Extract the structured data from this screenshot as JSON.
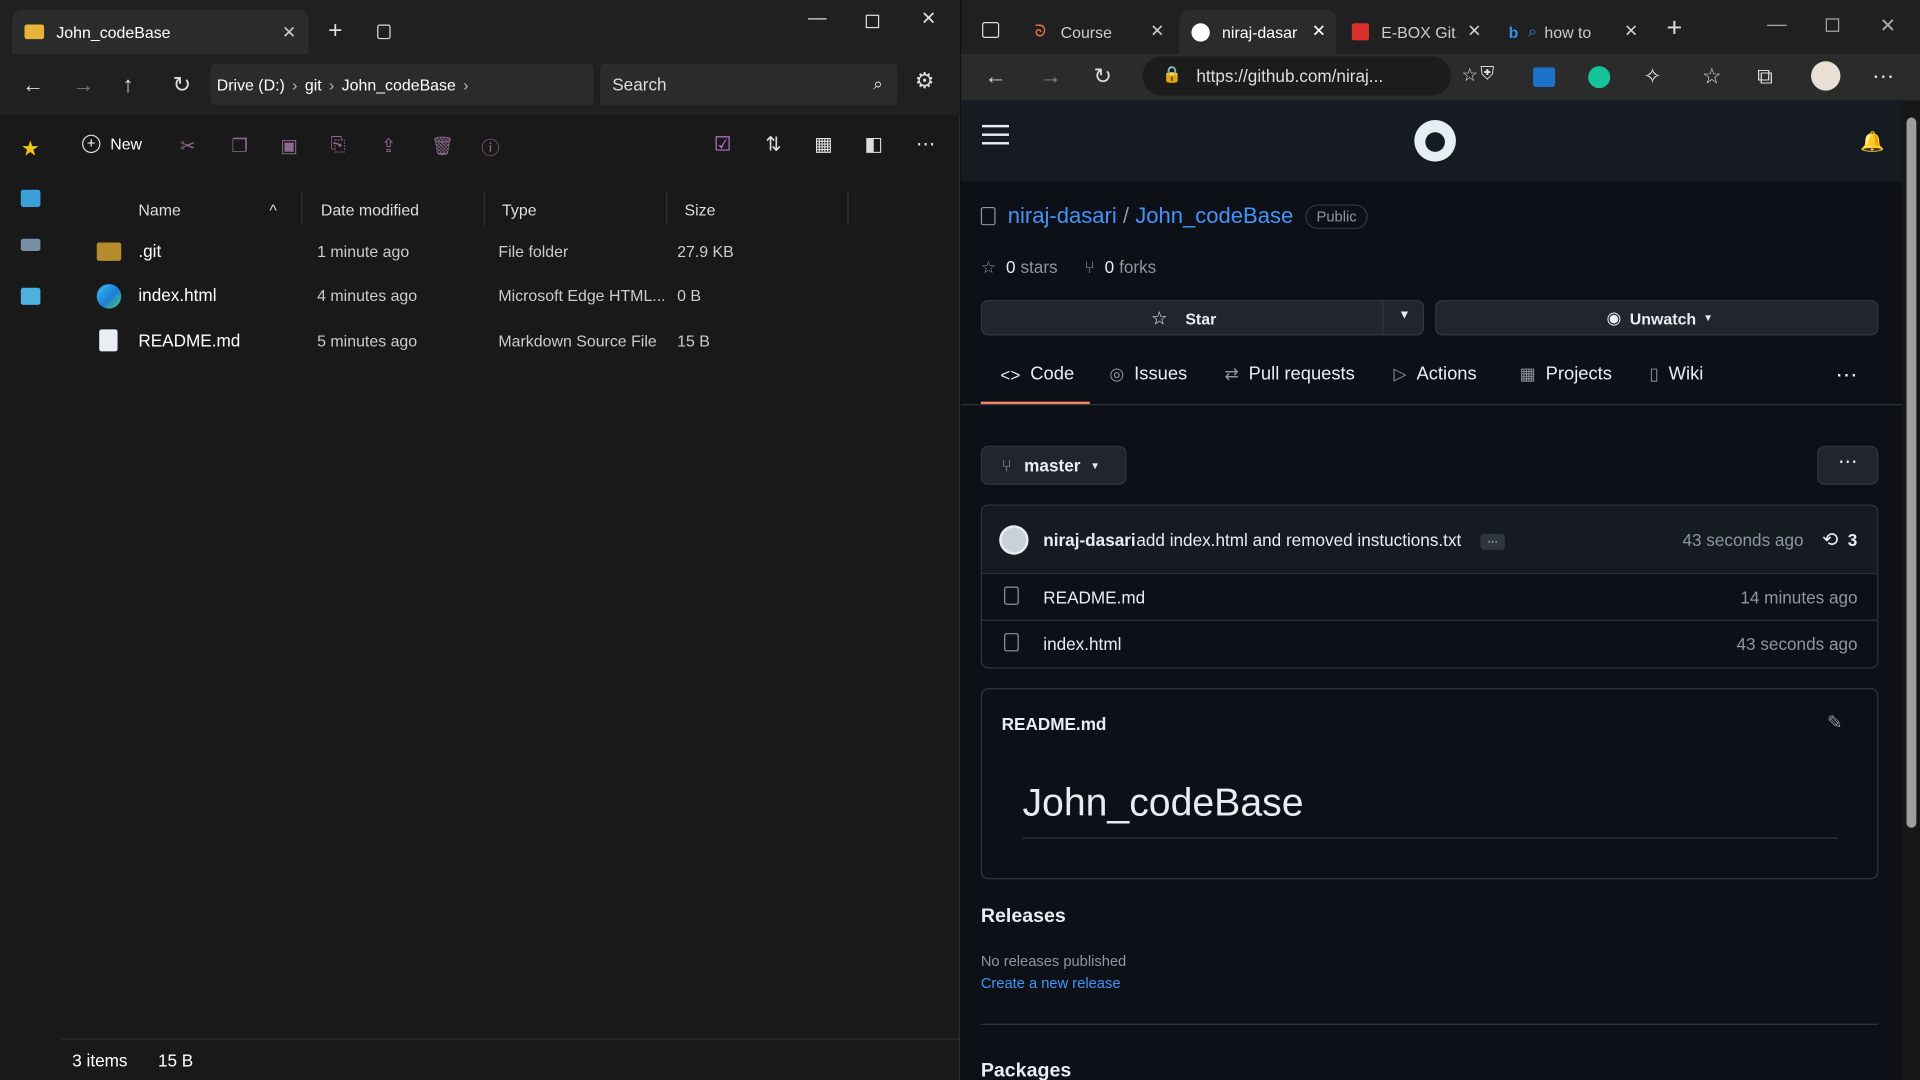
{
  "explorer": {
    "tab_title": "John_codeBase",
    "address": [
      "Drive (D:)",
      "git",
      "John_codeBase"
    ],
    "search_placeholder": "Search",
    "new_label": "New",
    "columns": [
      "Name",
      "Date modified",
      "Type",
      "Size"
    ],
    "rows": [
      {
        "name": ".git",
        "date": "1 minute ago",
        "type": "File folder",
        "size": "27.9 KB",
        "icon": "folder-icon"
      },
      {
        "name": "index.html",
        "date": "4 minutes ago",
        "type": "Microsoft Edge HTML...",
        "size": "0 B",
        "icon": "edge-icon"
      },
      {
        "name": "README.md",
        "date": "5 minutes ago",
        "type": "Markdown Source File",
        "size": "15 B",
        "icon": "markdown-file-icon"
      }
    ],
    "status_count": "3 items",
    "status_size": "15 B"
  },
  "browser": {
    "tabs": [
      "Course",
      "niraj-dasari",
      "E-BOX Git.p",
      "how to"
    ],
    "url": "https://github.com/niraj..."
  },
  "github": {
    "owner": "niraj-dasari",
    "repo": "John_codeBase",
    "visibility": "Public",
    "stars": "0",
    "stars_label": "stars",
    "forks": "0",
    "forks_label": "forks",
    "star_btn": "Star",
    "watch_btn": "Unwatch",
    "nav": [
      "Code",
      "Issues",
      "Pull requests",
      "Actions",
      "Projects",
      "Wiki"
    ],
    "branch": "master",
    "commit": {
      "author": "niraj-dasari",
      "message": "add index.html and removed instuctions.txt",
      "time": "43 seconds ago",
      "count": "3"
    },
    "files": [
      {
        "name": "README.md",
        "time": "14 minutes ago"
      },
      {
        "name": "index.html",
        "time": "43 seconds ago"
      }
    ],
    "readme_header": "README.md",
    "readme_title": "John_codeBase",
    "releases_title": "Releases",
    "no_releases": "No releases published",
    "create_release": "Create a new release",
    "packages_title": "Packages"
  },
  "colors": {
    "accent_link": "#4493f8",
    "tab_underline": "#f78166"
  }
}
